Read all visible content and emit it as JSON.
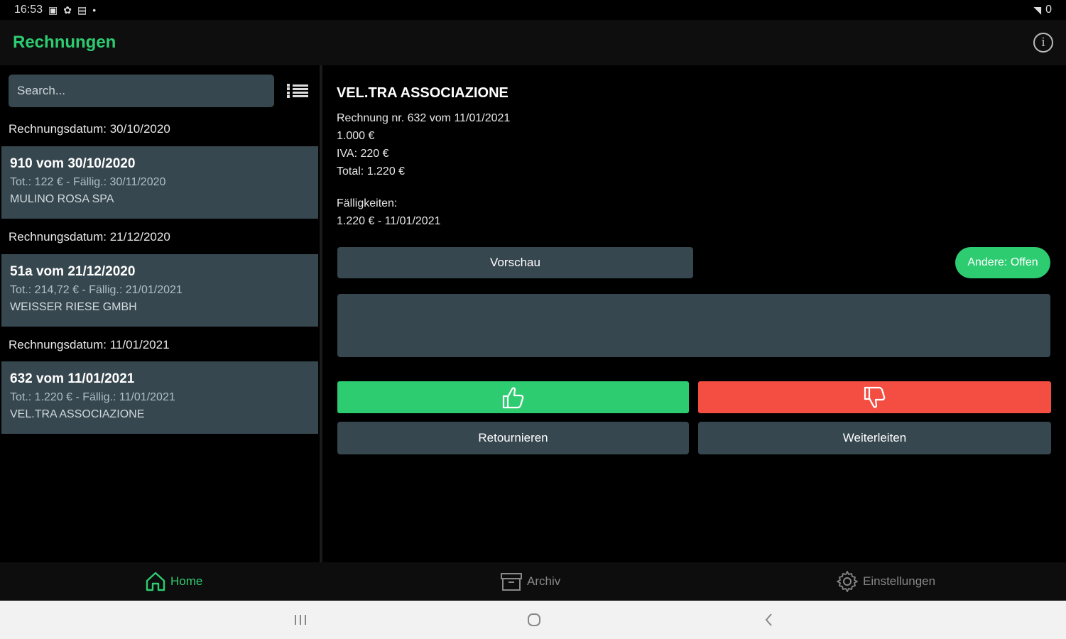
{
  "status_bar": {
    "time": "16:53",
    "battery": "0"
  },
  "app_bar": {
    "title": "Rechnungen",
    "info_icon": "info-icon"
  },
  "search": {
    "placeholder": "Search..."
  },
  "list": {
    "groups": [
      {
        "header": "Rechnungsdatum: 30/10/2020",
        "title": "910 vom 30/10/2020",
        "detail": "Tot.: 122 € - Fällig.: 30/11/2020",
        "company": "MULINO ROSA SPA"
      },
      {
        "header": "Rechnungsdatum: 21/12/2020",
        "title": "51a vom 21/12/2020",
        "detail": "Tot.: 214,72 € - Fällig.: 21/01/2021",
        "company": "WEISSER RIESE GMBH"
      },
      {
        "header": "Rechnungsdatum: 11/01/2021",
        "title": "632 vom 11/01/2021",
        "detail": "Tot.: 1.220 € - Fällig.: 11/01/2021",
        "company": "VEL.TRA ASSOCIAZIONE"
      }
    ]
  },
  "detail": {
    "company": "VEL.TRA ASSOCIAZIONE",
    "invoice": "Rechnung nr. 632 vom 11/01/2021",
    "net": "1.000 €",
    "vat": "IVA: 220 €",
    "total": "Total: 1.220 €",
    "due_label": "Fälligkeiten:",
    "due_value": "1.220 € - 11/01/2021",
    "preview_label": "Vorschau",
    "status_label": "Andere: Offen",
    "return_label": "Retournieren",
    "forward_label": "Weiterleiten"
  },
  "bottom_nav": {
    "home": "Home",
    "archive": "Archiv",
    "settings": "Einstellungen"
  },
  "colors": {
    "accent": "#2ecc71",
    "reject": "#f44e42",
    "card": "#37474f"
  }
}
